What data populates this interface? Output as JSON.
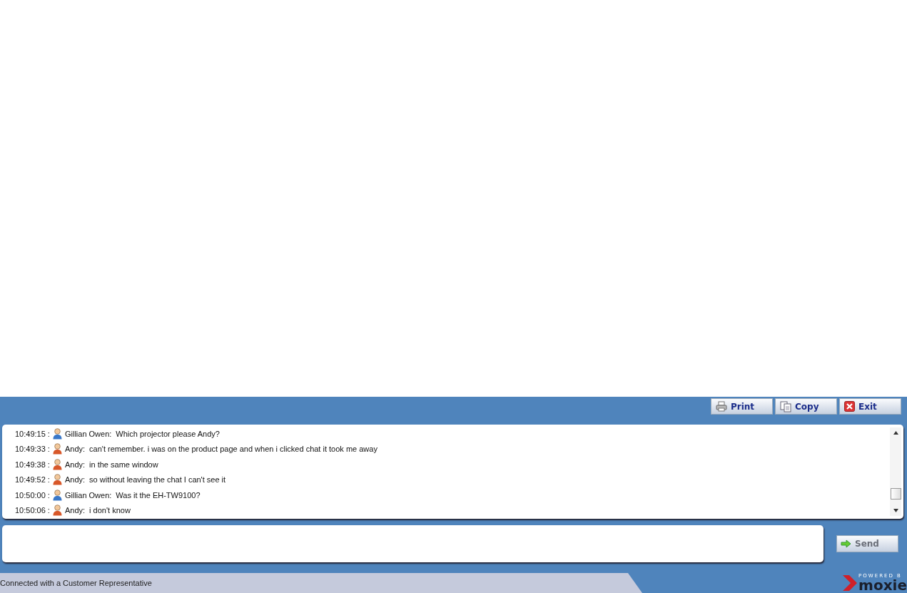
{
  "toolbar": {
    "buttons": [
      {
        "label": "Print",
        "kind": "print"
      },
      {
        "label": "Copy",
        "kind": "copy"
      },
      {
        "label": "Exit",
        "kind": "exit"
      }
    ]
  },
  "transcript": {
    "messages": [
      {
        "time": "10:49:15 :",
        "kind": "agent",
        "sender": "Gillian Owen:",
        "text": "Which projector please Andy?"
      },
      {
        "time": "10:49:33 :",
        "kind": "customer",
        "sender": "Andy:",
        "text": "can't remember. i was on the product page and when i clicked chat it took me away"
      },
      {
        "time": "10:49:38 :",
        "kind": "customer",
        "sender": "Andy:",
        "text": "in the same window"
      },
      {
        "time": "10:49:52 :",
        "kind": "customer",
        "sender": "Andy:",
        "text": "so without leaving the chat I can't see it"
      },
      {
        "time": "10:50:00 :",
        "kind": "agent",
        "sender": "Gillian Owen:",
        "text": "Was it the EH-TW9100?"
      },
      {
        "time": "10:50:06 :",
        "kind": "customer",
        "sender": "Andy:",
        "text": "i don't know"
      }
    ]
  },
  "send_button": {
    "label": "Send",
    "disabled": true
  },
  "status_bar": {
    "text": "Connected with a Customer Representative"
  },
  "branding": {
    "tagline": "POWERED B",
    "name": "moxie"
  }
}
